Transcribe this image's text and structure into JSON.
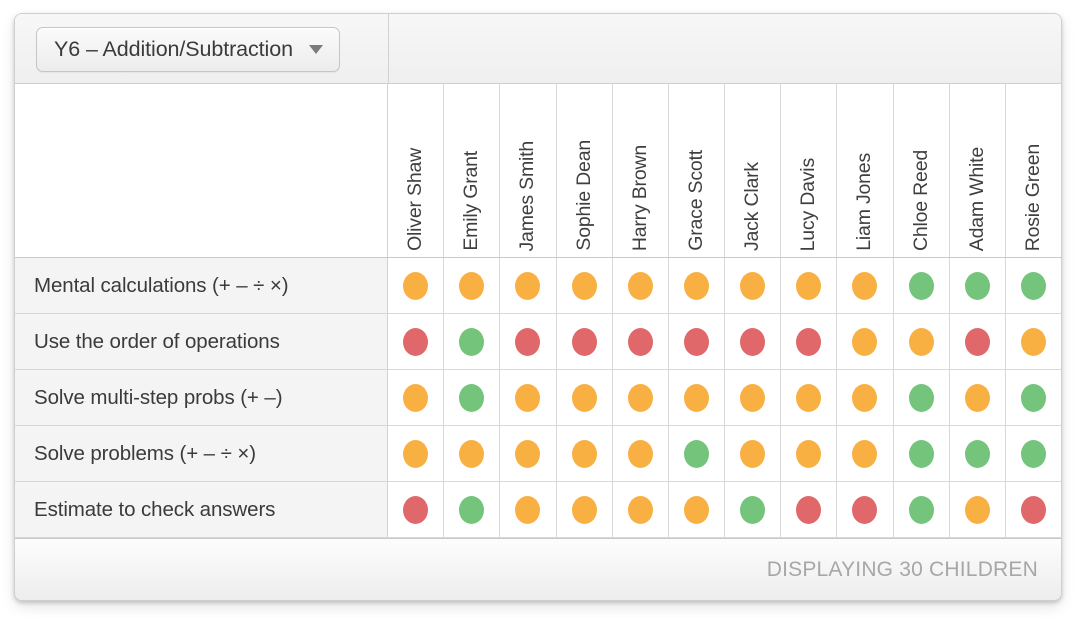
{
  "header": {
    "dropdown_label": "Y6 – Addition/Subtraction",
    "dropdown_caret": "chevron-down-icon"
  },
  "table": {
    "columns": [
      "Oliver Shaw",
      "Emily Grant",
      "James Smith",
      "Sophie Dean",
      "Harry Brown",
      "Grace Scott",
      "Jack Clark",
      "Lucy Davis",
      "Liam Jones",
      "Chloe Reed",
      "Adam White",
      "Rosie Green"
    ],
    "rows": [
      {
        "label": "Mental calculations (+ – ÷ ×)",
        "values": [
          "amber",
          "amber",
          "amber",
          "amber",
          "amber",
          "amber",
          "amber",
          "amber",
          "amber",
          "green",
          "green",
          "green"
        ]
      },
      {
        "label": "Use the order of operations",
        "values": [
          "red",
          "green",
          "red",
          "red",
          "red",
          "red",
          "red",
          "red",
          "amber",
          "amber",
          "red",
          "amber"
        ]
      },
      {
        "label": "Solve multi-step probs (+ –)",
        "values": [
          "amber",
          "green",
          "amber",
          "amber",
          "amber",
          "amber",
          "amber",
          "amber",
          "amber",
          "green",
          "amber",
          "green"
        ]
      },
      {
        "label": "Solve problems (+ – ÷ ×)",
        "values": [
          "amber",
          "amber",
          "amber",
          "amber",
          "amber",
          "green",
          "amber",
          "amber",
          "amber",
          "green",
          "green",
          "green"
        ]
      },
      {
        "label": "Estimate to check answers",
        "values": [
          "red",
          "green",
          "amber",
          "amber",
          "amber",
          "amber",
          "green",
          "red",
          "red",
          "green",
          "amber",
          "red"
        ]
      }
    ]
  },
  "footer": {
    "status_text": "DISPLAYING 30 CHILDREN"
  },
  "colors": {
    "green": "#74c47c",
    "amber": "#f9b043",
    "red": "#e0686a"
  }
}
